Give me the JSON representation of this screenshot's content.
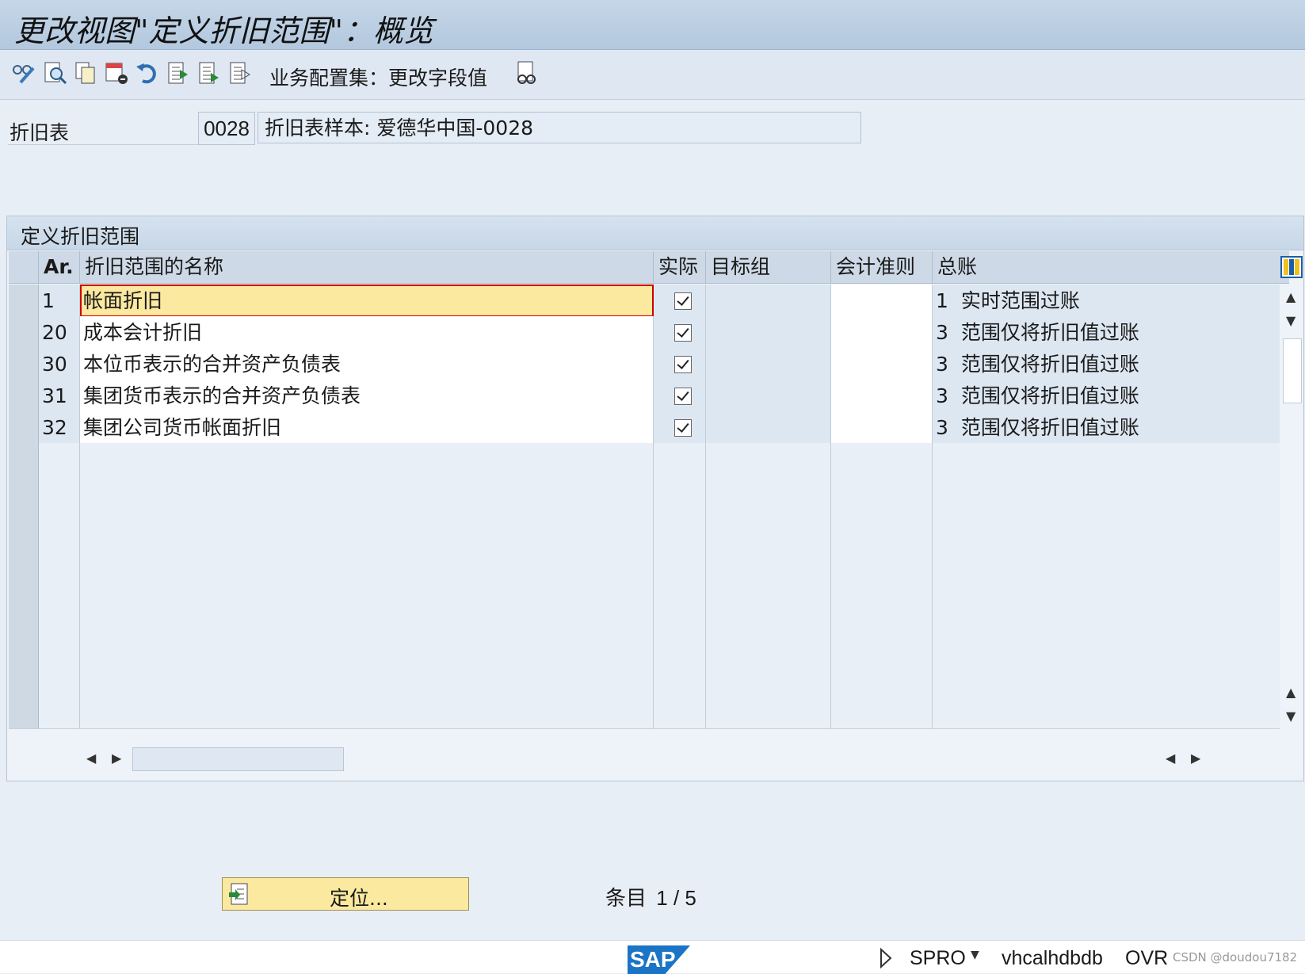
{
  "window": {
    "title": "更改视图\"定义折旧范围\"：概览"
  },
  "toolbar": {
    "icons": [
      "glasses-edit-icon",
      "search-detail-icon",
      "copy-icon",
      "delete-row-icon",
      "undo-icon",
      "select-all-icon",
      "select-block-icon",
      "deselect-icon",
      "glasses-icon"
    ],
    "bc_set_label": "业务配置集：更改字段值"
  },
  "header": {
    "label": "折旧表",
    "code": "0028",
    "description": "折旧表样本: 爱德华中国-0028"
  },
  "table": {
    "title": "定义折旧范围",
    "columns": [
      "Ar.",
      "折旧范围的名称",
      "实际",
      "目标组",
      "会计准则",
      "总账"
    ],
    "rows": [
      {
        "ar": "1",
        "name": "帐面折旧",
        "actual": true,
        "target_group": "",
        "accounting_principle": "",
        "gl_code": "1",
        "gl_text": "实时范围过账"
      },
      {
        "ar": "20",
        "name": "成本会计折旧",
        "actual": true,
        "target_group": "",
        "accounting_principle": "",
        "gl_code": "3",
        "gl_text": "范围仅将折旧值过账"
      },
      {
        "ar": "30",
        "name": "本位币表示的合并资产负债表",
        "actual": true,
        "target_group": "",
        "accounting_principle": "",
        "gl_code": "3",
        "gl_text": "范围仅将折旧值过账"
      },
      {
        "ar": "31",
        "name": "集团货币表示的合并资产负债表",
        "actual": true,
        "target_group": "",
        "accounting_principle": "",
        "gl_code": "3",
        "gl_text": "范围仅将折旧值过账"
      },
      {
        "ar": "32",
        "name": "集团公司货币帐面折旧",
        "actual": true,
        "target_group": "",
        "accounting_principle": "",
        "gl_code": "3",
        "gl_text": "范围仅将折旧值过账"
      }
    ],
    "empty_rows": 9
  },
  "footer": {
    "position_button": "定位...",
    "entry_label": "条目",
    "entry_value": "1 / 5"
  },
  "statusbar": {
    "logo": "SAP",
    "transaction": "SPRO",
    "server": "vhcalhdbdb",
    "mode": "OVR",
    "watermark": "CSDN @doudou7182"
  },
  "colors": {
    "title_bg": "#b3c8de",
    "selected_row": "#fbe9a0",
    "button_bg": "#fbe9a0",
    "cursor_marker": "#d00000"
  }
}
